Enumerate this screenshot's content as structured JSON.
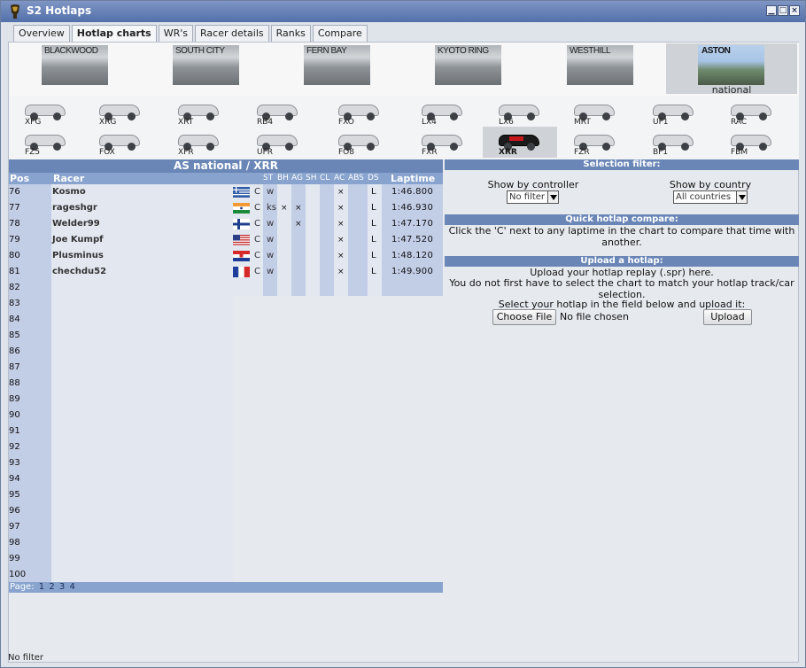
{
  "window": {
    "title": "S2 Hotlaps"
  },
  "tabs": [
    {
      "label": "Overview"
    },
    {
      "label": "Hotlap charts"
    },
    {
      "label": "WR's"
    },
    {
      "label": "Racer details"
    },
    {
      "label": "Ranks"
    },
    {
      "label": "Compare"
    }
  ],
  "tracks": [
    {
      "name": "BLACKWOOD"
    },
    {
      "name": "SOUTH CITY"
    },
    {
      "name": "FERN BAY"
    },
    {
      "name": "KYOTO RING"
    },
    {
      "name": "WESTHILL"
    },
    {
      "name": "ASTON",
      "layout": "national"
    }
  ],
  "cars": [
    "XFG",
    "XRG",
    "XRT",
    "RB4",
    "FXO",
    "LX4",
    "LX6",
    "MRT",
    "UF1",
    "RAC",
    "FZ5",
    "FOX",
    "XFR",
    "UFR",
    "FO8",
    "FXR",
    "XRR",
    "FZR",
    "BF1",
    "FBM"
  ],
  "chart": {
    "title": "AS national / XRR",
    "headers": {
      "pos": "Pos",
      "racer": "Racer",
      "st": "ST",
      "bh": "BH",
      "ag": "AG",
      "sh": "SH",
      "cl": "CL",
      "ac": "AC",
      "abs": "ABS",
      "ds": "DS",
      "laptime": "Laptime"
    },
    "rows": [
      {
        "pos": "76",
        "racer": "Kosmo",
        "country": "greece",
        "c": "C",
        "st": "w",
        "bh": "",
        "ag": "",
        "ac": "×",
        "ds": "L",
        "laptime": "1:46.800"
      },
      {
        "pos": "77",
        "racer": "rageshgr",
        "country": "india",
        "c": "C",
        "st": "ks",
        "bh": "×",
        "ag": "×",
        "ac": "×",
        "ds": "L",
        "laptime": "1:46.930"
      },
      {
        "pos": "78",
        "racer": "Welder99",
        "country": "finland",
        "c": "C",
        "st": "w",
        "bh": "",
        "ag": "×",
        "ac": "×",
        "ds": "L",
        "laptime": "1:47.170"
      },
      {
        "pos": "79",
        "racer": "Joe Kumpf",
        "country": "usa",
        "c": "C",
        "st": "w",
        "bh": "",
        "ag": "",
        "ac": "×",
        "ds": "L",
        "laptime": "1:47.520"
      },
      {
        "pos": "80",
        "racer": "Plusminus",
        "country": "croatia",
        "c": "C",
        "st": "w",
        "bh": "",
        "ag": "",
        "ac": "×",
        "ds": "L",
        "laptime": "1:48.120"
      },
      {
        "pos": "81",
        "racer": "chechdu52",
        "country": "france",
        "c": "C",
        "st": "w",
        "bh": "",
        "ag": "",
        "ac": "×",
        "ds": "L",
        "laptime": "1:49.900"
      }
    ],
    "empty_positions": [
      "82",
      "83",
      "84",
      "85",
      "86",
      "87",
      "88",
      "89",
      "90",
      "91",
      "92",
      "93",
      "94",
      "95",
      "96",
      "97",
      "98",
      "99",
      "100"
    ],
    "pager": {
      "label": "Page:",
      "pages": [
        "1",
        "2",
        "3",
        "4"
      ]
    }
  },
  "selection_filter": {
    "title": "Selection filter:",
    "controller_label": "Show by controller",
    "controller_value": "No filter",
    "country_label": "Show by country",
    "country_value": "All countries"
  },
  "quick_compare": {
    "title": "Quick hotlap compare:",
    "text": "Click the 'C' next to any laptime in the chart to compare that time with another."
  },
  "upload": {
    "title": "Upload a hotlap:",
    "line1": "Upload your hotlap replay (.spr) here.",
    "line2": "You do not first have to select the chart to match your hotlap track/car selection.",
    "line3": "Select your hotlap in the field below and upload it:",
    "choose_file": "Choose File",
    "no_file": "No file chosen",
    "upload_button": "Upload"
  },
  "status": "No filter"
}
